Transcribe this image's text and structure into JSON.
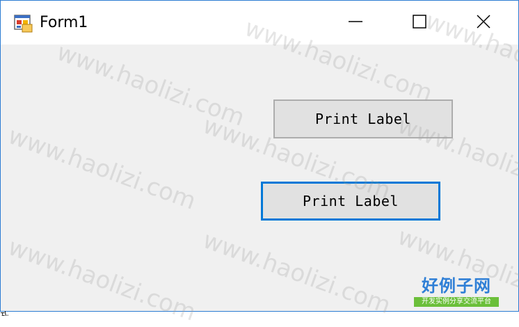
{
  "window": {
    "title": "Form1",
    "icon": "winforms-app-icon",
    "controls": {
      "minimize_icon": "minimize-icon",
      "maximize_icon": "maximize-icon",
      "close_icon": "close-icon"
    }
  },
  "form": {
    "buttons": [
      {
        "label": "Print Label",
        "state": "normal"
      },
      {
        "label": "Print Label",
        "state": "focused"
      }
    ]
  },
  "watermark": {
    "text": "www.haolizi.com"
  },
  "logo": {
    "title": "好例子网",
    "tagline": "开发实例分享交流平台"
  },
  "footer": {
    "fragment": "式"
  },
  "colors": {
    "window_border": "#2b7cd3",
    "focus_border": "#0078d7",
    "client_bg": "#f0f0f0",
    "button_bg": "#e1e1e1",
    "logo_blue": "#2f7fd6",
    "logo_green": "#6bbf3a"
  }
}
